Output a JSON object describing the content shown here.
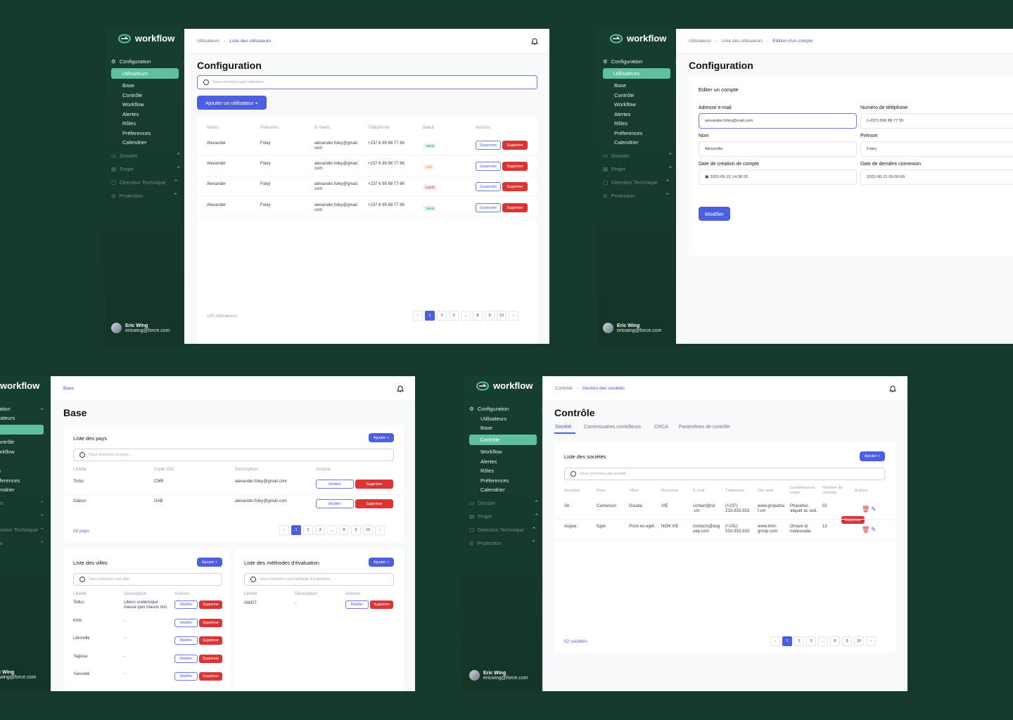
{
  "colors": {
    "background": "#14392d",
    "sidebar": "#163f31",
    "accent": "#5fbf9e",
    "primary": "#4c5fe0",
    "danger": "#d93535"
  },
  "sidebar": {
    "brand": "workflow",
    "config_label": "Configuration",
    "config_items": [
      "Utilisateurs",
      "Base",
      "Contrôle",
      "Workflow",
      "Alertes",
      "Rôles",
      "Préferences",
      "Calendrier"
    ],
    "sections": [
      "Dossier",
      "Projet",
      "Direction Technique",
      "Protection"
    ],
    "user_name": "Eric Wing",
    "user_email": "ericwing@force.com"
  },
  "panel_users": {
    "breadcrumb": [
      "Utilisateurs",
      "Liste des utilisateurs"
    ],
    "title": "Configuration",
    "search_placeholder": "Vous cherchez quel utilisateur ...",
    "add_button": "Ajouter un utilisateur +",
    "columns": [
      "Noms",
      "Prénoms",
      "E-mails",
      "Téléphone",
      "Statut",
      "Actions"
    ],
    "rows": [
      {
        "nom": "Alexander",
        "prenom": "Foley",
        "email1": "alexander.foley@gmail.",
        "email2": "com",
        "tel": "+237 6 99 88 77 66",
        "statut": "Validé"
      },
      {
        "nom": "Alexander",
        "prenom": "Foley",
        "email1": "alexander.foley@gmail.",
        "email2": "com",
        "tel": "+237 6 99 88 77 66",
        "statut": "Actif"
      },
      {
        "nom": "Alexander",
        "prenom": "Foley",
        "email1": "alexander.foley@gmail.",
        "email2": "com",
        "tel": "+237 6 99 88 77 66",
        "statut": "Inactif"
      },
      {
        "nom": "Alexander",
        "prenom": "Foley",
        "email1": "alexander.foley@gmail.",
        "email2": "com",
        "tel": "+237 6 99 88 77 66",
        "statut": "Validé"
      }
    ],
    "suspend_label": "Suspendre",
    "delete_label": "Supprimer",
    "count": "100 utilisateurs",
    "pages": [
      "‹",
      "1",
      "2",
      "3",
      "...",
      "8",
      "9",
      "10",
      "›"
    ]
  },
  "panel_edit": {
    "breadcrumb": [
      "Utilisateurs",
      "Liste des utilisateurs",
      "Edition d'un compte"
    ],
    "title": "Configuration",
    "card_title": "Editer un compte",
    "email_label": "Adresse e-mail",
    "email_value": "alexander.foley@mail.com",
    "phone_label": "Numéro de téléphone",
    "phone_value": "(+237) 696 88 77 55",
    "nom_label": "Nom",
    "nom_value": "Alexander",
    "prenom_label": "Prénom",
    "prenom_value": "Foley",
    "created_label": "Date de création de compte",
    "created_value": "2022-06-21 14:30:25",
    "lastlogin_label": "Date de dernière connexion",
    "lastlogin_value": "2022-06-21 00:00:00",
    "submit": "Modifier"
  },
  "panel_base": {
    "breadcrumb": [
      "Base"
    ],
    "title": "Base",
    "pays": {
      "title": "Liste des pays",
      "add": "Ajouter +",
      "search": "Vous cherchez un pays ...",
      "columns": [
        "Libellé",
        "Code ISO",
        "Description",
        "Actions"
      ],
      "rows": [
        {
          "lib": "Tortor.",
          "iso": "CMR",
          "desc": "alexander.foley@gmail.com"
        },
        {
          "lib": "Gabon",
          "iso": "GAB",
          "desc": "alexander.foley@gmail.com"
        }
      ],
      "count": "02 pays"
    },
    "villes": {
      "title": "Liste des villes",
      "add": "Ajouter +",
      "search": "Vous cherchez une ville ...",
      "columns": [
        "Libellé",
        "Description",
        "Actions"
      ],
      "rows": [
        {
          "lib": "Tellus.",
          "desc1": "Libero scelerisque",
          "desc2": "massa quis mauris nisl."
        },
        {
          "lib": "Kribi",
          "desc1": "-",
          "desc2": ""
        },
        {
          "lib": "Libreville",
          "desc1": "-",
          "desc2": ""
        },
        {
          "lib": "Yagoua",
          "desc1": "-",
          "desc2": ""
        },
        {
          "lib": "Yaoundé",
          "desc1": "-",
          "desc2": ""
        }
      ]
    },
    "methodes": {
      "title": "Liste des méthodes d'évaluation",
      "add": "Ajouter +",
      "search": "Vous cherchez une méthode d'évaluation ...",
      "columns": [
        "Libellé",
        "Description",
        "Actions"
      ],
      "rows": [
        {
          "lib": "SWOT",
          "desc": "-"
        }
      ]
    },
    "modify_label": "Modifier",
    "delete_label": "Supprimer",
    "pages": [
      "‹",
      "1",
      "2",
      "3",
      "...",
      "8",
      "9",
      "10",
      "›"
    ]
  },
  "panel_controle": {
    "breadcrumb": [
      "Contrôle",
      "Gestion des sociétés"
    ],
    "title": "Contrôle",
    "tabs": [
      "Société",
      "Commissaires contrôleurs",
      "CRCA",
      "Paramètres de contrôle"
    ],
    "card_title": "Liste des sociétés",
    "add": "Ajouter +",
    "search": "Vous cherchez une société...",
    "columns": [
      "Sociétés",
      "Pays",
      "Villes",
      "Branches",
      "E-mail",
      "Téléphone",
      "Site web",
      "Commissa ire respo.",
      "Nombre de contrôle",
      "Actions"
    ],
    "rows": [
      {
        "soc": "Sit.",
        "pays": "Cameroun",
        "ville": "Douala",
        "branche": "VIE",
        "email1": "contact@sit",
        "email2": ".cm",
        "tel1": "(+237)",
        "tel2": "233-333-333",
        "web1": "www.gropama",
        "web2": "f.cm",
        "com1": "Phasellus",
        "com2": "aliquet ac sed.",
        "nb": "02"
      },
      {
        "soc": "Augue.",
        "pays": "Eget.",
        "ville": "Proin eu eget.",
        "branche": "NON VIE",
        "email1": "contacts@aug",
        "email2": "uep.com",
        "tel1": "(+241)",
        "tel2": "033-333-333",
        "web1": "www.khm-",
        "web2": "group.com",
        "com1": "Ornare id",
        "com2": "malesuada.",
        "nb": "13"
      }
    ],
    "tooltip": "Supprimer",
    "count": "02 sociétés",
    "pages": [
      "‹",
      "1",
      "2",
      "3",
      "...",
      "8",
      "9",
      "10",
      "›"
    ]
  }
}
